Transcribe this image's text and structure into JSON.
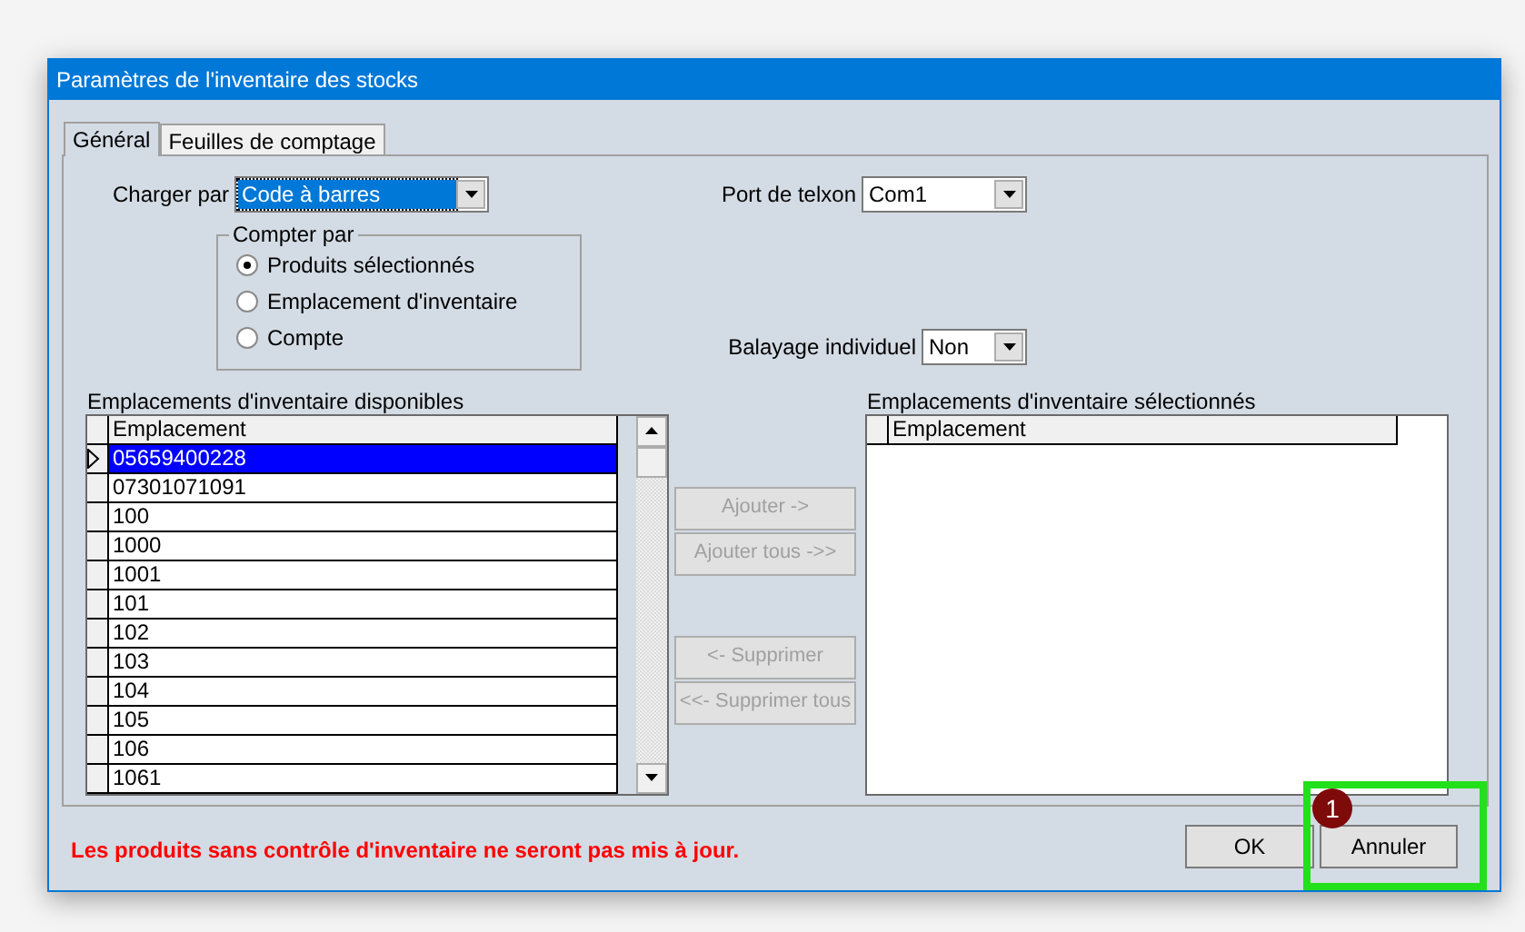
{
  "window": {
    "title": "Paramètres de l'inventaire des stocks"
  },
  "tabs": [
    {
      "label": "Général",
      "selected": true
    },
    {
      "label": "Feuilles de comptage",
      "selected": false
    }
  ],
  "charger_par": {
    "label": "Charger par",
    "value": "Code à barres"
  },
  "compter_par": {
    "title": "Compter par",
    "options": [
      {
        "label": "Produits sélectionnés",
        "selected": true
      },
      {
        "label": "Emplacement d'inventaire",
        "selected": false
      },
      {
        "label": "Compte",
        "selected": false
      }
    ]
  },
  "port_telxon": {
    "label": "Port de telxon",
    "value": "Com1"
  },
  "balayage": {
    "label": "Balayage individuel",
    "value": "Non"
  },
  "available": {
    "title": "Emplacements d'inventaire disponibles",
    "column": "Emplacement",
    "rows": [
      {
        "value": "05659400228",
        "selected": true
      },
      {
        "value": "07301071091",
        "selected": false
      },
      {
        "value": "100",
        "selected": false
      },
      {
        "value": "1000",
        "selected": false
      },
      {
        "value": "1001",
        "selected": false
      },
      {
        "value": "101",
        "selected": false
      },
      {
        "value": "102",
        "selected": false
      },
      {
        "value": "103",
        "selected": false
      },
      {
        "value": "104",
        "selected": false
      },
      {
        "value": "105",
        "selected": false
      },
      {
        "value": "106",
        "selected": false
      },
      {
        "value": "1061",
        "selected": false
      }
    ]
  },
  "move_buttons": [
    {
      "label": "Ajouter ->",
      "disabled": true
    },
    {
      "label": "Ajouter tous ->>",
      "disabled": true
    },
    {
      "label": "<- Supprimer",
      "disabled": true
    },
    {
      "label": "<<- Supprimer tous",
      "disabled": true
    }
  ],
  "selected_list": {
    "title": "Emplacements d'inventaire sélectionnés",
    "column": "Emplacement"
  },
  "warning": "Les produits sans contrôle d'inventaire ne seront pas mis à jour.",
  "buttons": [
    {
      "label": "OK"
    },
    {
      "label": "Annuler",
      "highlighted": true
    }
  ],
  "callout": {
    "number": "1"
  }
}
